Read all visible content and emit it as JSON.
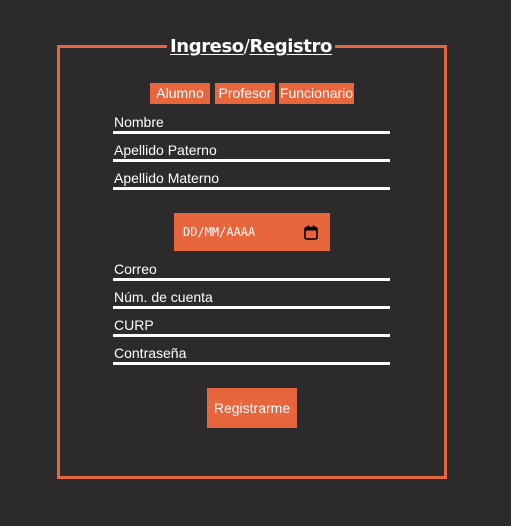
{
  "header": {
    "login_link": "Ingreso",
    "separator": "/",
    "register_link": "Registro"
  },
  "roles": [
    {
      "label": "Alumno"
    },
    {
      "label": "Profesor"
    },
    {
      "label": "Funcionario"
    }
  ],
  "fields": {
    "nombre": "Nombre",
    "apellido_paterno": "Apellido Paterno",
    "apellido_materno": "Apellido Materno",
    "correo": "Correo",
    "num_cuenta": "Núm. de cuenta",
    "curp": "CURP",
    "contrasena": "Contraseña"
  },
  "date_input": {
    "placeholder": "DD/MM/AAAA",
    "icon": "calendar-icon"
  },
  "submit_label": "Registrarme",
  "colors": {
    "background": "#2c2a2b",
    "accent": "#e8663e",
    "text": "#ffffff"
  }
}
